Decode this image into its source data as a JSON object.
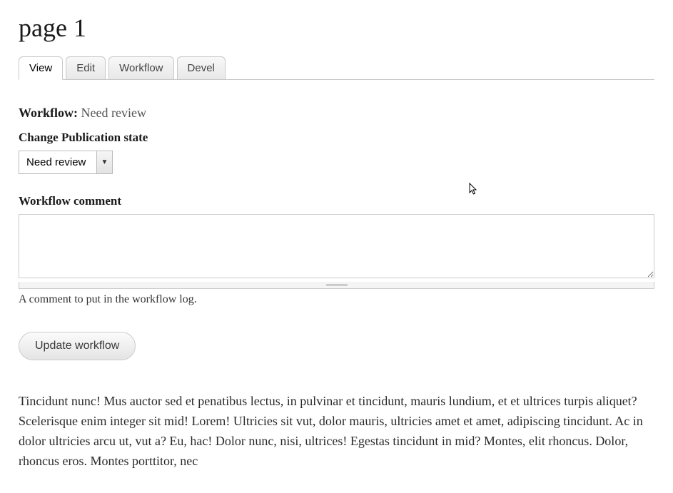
{
  "page": {
    "title": "page 1"
  },
  "tabs": {
    "items": [
      {
        "label": "View",
        "active": true
      },
      {
        "label": "Edit",
        "active": false
      },
      {
        "label": "Workflow",
        "active": false
      },
      {
        "label": "Devel",
        "active": false
      }
    ]
  },
  "workflow": {
    "status_label": "Workflow:",
    "status_value": "Need review",
    "change_state_label": "Change Publication state",
    "state_select_value": "Need review",
    "comment_label": "Workflow comment",
    "comment_value": "",
    "comment_help": "A comment to put in the workflow log.",
    "submit_label": "Update workflow"
  },
  "content": {
    "body": "Tincidunt nunc! Mus auctor sed et penatibus lectus, in pulvinar et tincidunt, mauris lundium, et et ultrices turpis aliquet? Scelerisque enim integer sit mid! Lorem! Ultricies sit vut, dolor mauris, ultricies amet et amet, adipiscing tincidunt. Ac in dolor ultricies arcu ut, vut a? Eu, hac! Dolor nunc, nisi, ultrices! Egestas tincidunt in mid? Montes, elit rhoncus. Dolor, rhoncus eros. Montes porttitor, nec"
  }
}
